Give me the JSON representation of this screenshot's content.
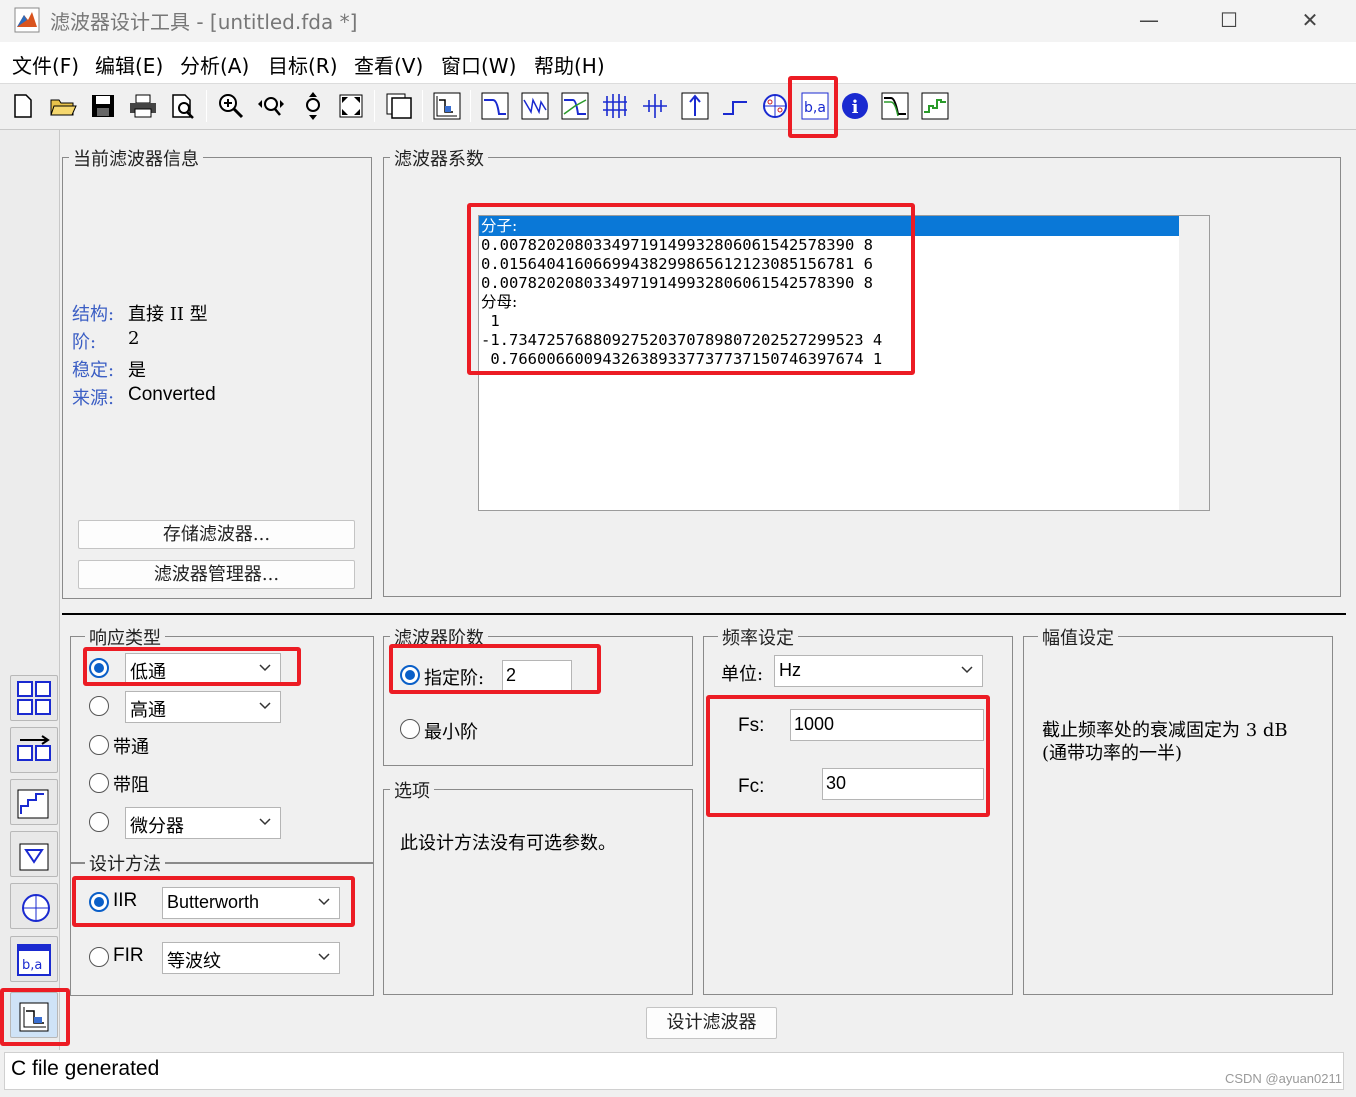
{
  "window": {
    "title": "滤波器设计工具 -  [untitled.fda *]",
    "minimize": "—",
    "maximize": "☐",
    "close": "✕"
  },
  "menu": [
    "文件(F)",
    "编辑(E)",
    "分析(A)",
    "目标(R)",
    "查看(V)",
    "窗口(W)",
    "帮助(H)"
  ],
  "toolbar": {
    "icons": [
      "new-file-icon",
      "open-folder-icon",
      "save-icon",
      "print-icon",
      "print-preview-icon",
      "zoom-in-icon",
      "zoom-x-icon",
      "zoom-y-icon",
      "full-view-icon",
      "new-figure-icon",
      "filter-spec-icon",
      "magnitude-response-icon",
      "phase-response-icon",
      "mag-phase-icon",
      "group-delay-icon",
      "phase-delay-icon",
      "impulse-response-icon",
      "step-response-icon",
      "pole-zero-icon",
      "filter-coefficients-icon",
      "filter-info-icon",
      "magnitude-estimate-icon",
      "round-off-noise-icon"
    ],
    "highlighted": "filter-coefficients-icon"
  },
  "filter_info": {
    "title": "当前滤波器信息",
    "rows": [
      {
        "key": "结构:",
        "value": "直接 II 型"
      },
      {
        "key": "阶:",
        "value": "2"
      },
      {
        "key": "稳定:",
        "value": "是"
      },
      {
        "key": "来源:",
        "value": "Converted"
      }
    ],
    "store_button": "存储滤波器...",
    "manager_button": "滤波器管理器..."
  },
  "coefficients": {
    "title": "滤波器系数",
    "lines": [
      "分子:",
      "0.00782020803349719149932806061542578390 8",
      "0.01564041606699438299865612123085156781 6",
      "0.00782020803349719149932806061542578390 8",
      "分母:",
      " 1",
      "-1.73472576880927520370789807202527299523 4",
      " 0.76600660094326389337737737150746397674 1"
    ]
  },
  "response_type": {
    "title": "响应类型",
    "options": [
      {
        "label": "低通",
        "selected": true,
        "has_dropdown": true
      },
      {
        "label": "高通",
        "selected": false,
        "has_dropdown": true
      },
      {
        "label": "带通",
        "selected": false,
        "has_dropdown": false
      },
      {
        "label": "带阻",
        "selected": false,
        "has_dropdown": false
      },
      {
        "label": "微分器",
        "selected": false,
        "has_dropdown": true
      }
    ]
  },
  "design_method": {
    "title": "设计方法",
    "iir_label": "IIR",
    "iir_value": "Butterworth",
    "fir_label": "FIR",
    "fir_value": "等波纹",
    "selected": "IIR"
  },
  "filter_order": {
    "title": "滤波器阶数",
    "specify_label": "指定阶:",
    "specify_value": "2",
    "minimum_label": "最小阶"
  },
  "options": {
    "title": "选项",
    "text": "此设计方法没有可选参数。"
  },
  "frequency": {
    "title": "频率设定",
    "unit_label": "单位:",
    "unit_value": "Hz",
    "fs_label": "Fs:",
    "fs_value": "1000",
    "fc_label": "Fc:",
    "fc_value": "30"
  },
  "magnitude": {
    "title": "幅值设定",
    "line1": "截止频率处的衰减固定为 3 dB",
    "line2": "(通带功率的一半)"
  },
  "design_button": "设计滤波器",
  "status": "C file generated",
  "watermark": "CSDN @ayuan0211",
  "colors": {
    "highlight": "#ec1c24",
    "selection": "#0a78d7",
    "info_key": "#3b5ec4"
  }
}
